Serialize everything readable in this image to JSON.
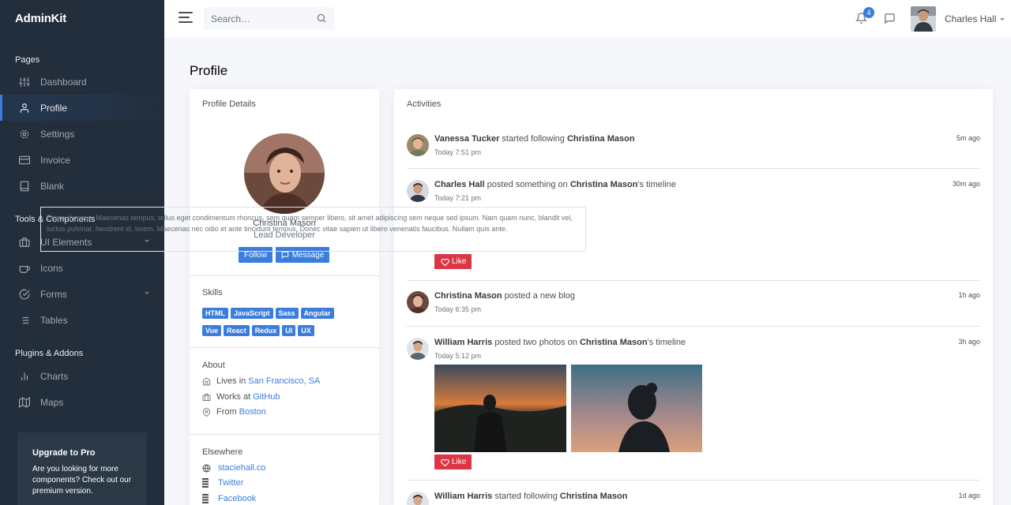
{
  "brand": "AdminKit",
  "sidebar": {
    "headers": [
      "Pages",
      "Tools & Components",
      "Plugins & Addons"
    ],
    "items": [
      {
        "label": "Dashboard",
        "icon": "sliders-icon"
      },
      {
        "label": "Profile",
        "icon": "user-icon",
        "active": true
      },
      {
        "label": "Settings",
        "icon": "settings-icon"
      },
      {
        "label": "Invoice",
        "icon": "credit-card-icon"
      },
      {
        "label": "Blank",
        "icon": "book-icon"
      },
      {
        "label": "UI Elements",
        "icon": "briefcase-icon",
        "expandable": true
      },
      {
        "label": "Icons",
        "icon": "coffee-icon"
      },
      {
        "label": "Forms",
        "icon": "check-circle-icon",
        "expandable": true
      },
      {
        "label": "Tables",
        "icon": "list-icon"
      },
      {
        "label": "Charts",
        "icon": "bar-chart-icon"
      },
      {
        "label": "Maps",
        "icon": "map-icon"
      }
    ],
    "upgrade": {
      "title": "Upgrade to Pro",
      "description": "Are you looking for more components? Check out our premium version."
    }
  },
  "topbar": {
    "search_placeholder": "Search…",
    "notification_count": "4",
    "user_name": "Charles Hall"
  },
  "page_title": "Profile",
  "profile": {
    "card_title": "Profile Details",
    "name": "Christina Mason",
    "role": "Lead Developer",
    "follow_label": "Follow",
    "message_label": "Message",
    "skills_title": "Skills",
    "skills": [
      "HTML",
      "JavaScript",
      "Sass",
      "Angular",
      "Vue",
      "React",
      "Redux",
      "UI",
      "UX"
    ],
    "about_title": "About",
    "about": [
      {
        "prefix": "Lives in",
        "link": "San Francisco, SA",
        "icon": "home-icon"
      },
      {
        "prefix": "Works at",
        "link": "GitHub",
        "icon": "briefcase-icon"
      },
      {
        "prefix": "From",
        "link": "Boston",
        "icon": "map-pin-icon"
      }
    ],
    "elsewhere_title": "Elsewhere",
    "elsewhere": [
      {
        "label": "staciehall.co",
        "icon": "globe-icon"
      },
      {
        "label": "Twitter",
        "icon": "twitter-icon"
      },
      {
        "label": "Facebook",
        "icon": "facebook-icon"
      }
    ]
  },
  "activities": {
    "title": "Activities",
    "like_label": "Like",
    "items": [
      {
        "actor": "Vanessa Tucker",
        "verb": "started following",
        "target": "Christina Mason",
        "suffix": "",
        "time": "Today 7:51 pm",
        "ago": "5m ago"
      },
      {
        "actor": "Charles Hall",
        "verb": "posted something on",
        "target": "Christina Mason",
        "suffix": "'s timeline",
        "time": "Today 7:21 pm",
        "ago": "30m ago",
        "text": "Etiam rhoncus. Maecenas tempus, tellus eget condimentum rhoncus, sem quam semper libero, sit amet adipiscing sem neque sed ipsum. Nam quam nunc, blandit vel, luctus pulvinar, hendrerit id, lorem. Maecenas nec odio et ante tincidunt tempus. Donec vitae sapien ut libero venenatis faucibus. Nullam quis ante."
      },
      {
        "actor": "Christina Mason",
        "verb": "posted a new blog",
        "target": "",
        "suffix": "",
        "time": "Today 6:35 pm",
        "ago": "1h ago"
      },
      {
        "actor": "William Harris",
        "verb": "posted two photos on",
        "target": "Christina Mason",
        "suffix": "'s timeline",
        "time": "Today 5:12 pm",
        "ago": "3h ago"
      },
      {
        "actor": "William Harris",
        "verb": "started following",
        "target": "Christina Mason",
        "suffix": "",
        "time": "",
        "ago": "1d ago"
      }
    ]
  },
  "colors": {
    "primary": "#3b7ddd",
    "sidebar": "#222e3c",
    "danger": "#dc3545"
  }
}
